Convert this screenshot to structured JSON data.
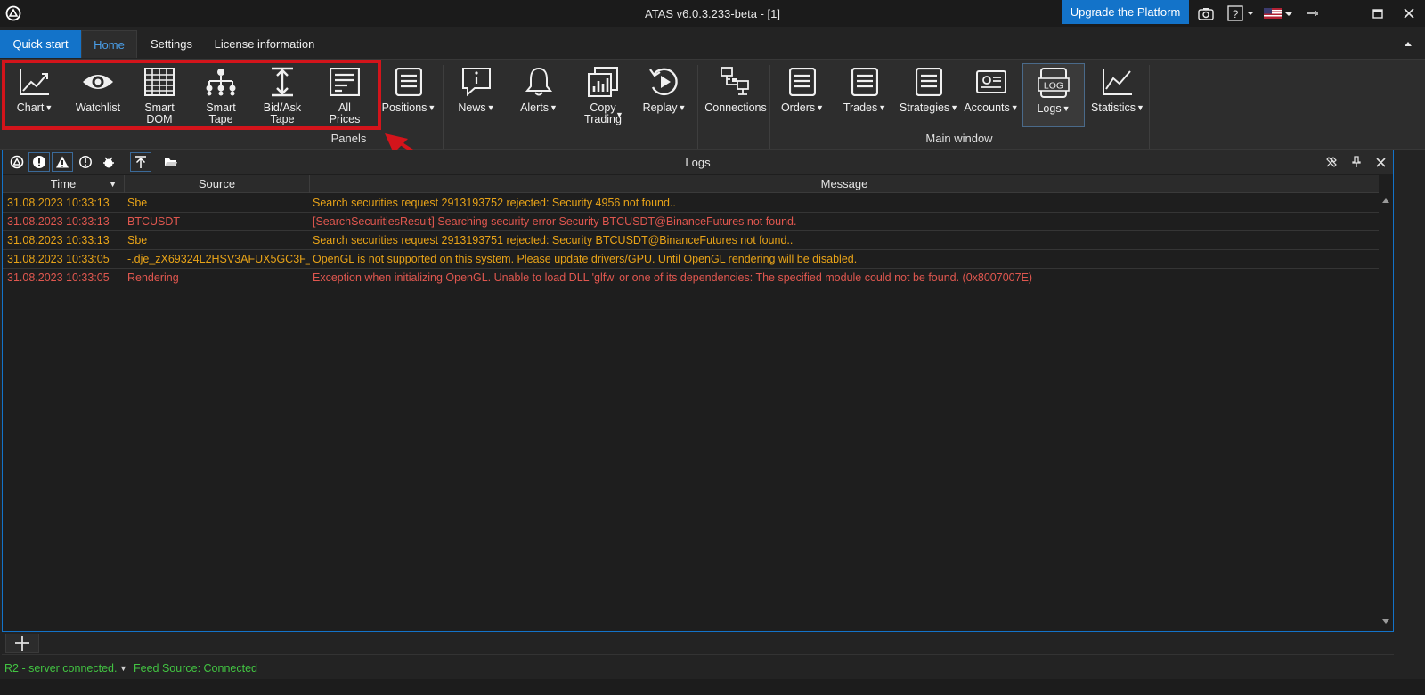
{
  "window": {
    "title": "ATAS v6.0.3.233-beta - [1]",
    "upgrade_label": "Upgrade the Platform",
    "icons": [
      "atas-logo-icon",
      "camera-icon",
      "help-icon",
      "us-flag-icon",
      "pin-icon",
      "maximize-icon",
      "close-icon"
    ]
  },
  "menu": {
    "tabs": [
      "Quick start",
      "Home",
      "Settings",
      "License information"
    ]
  },
  "ribbon": {
    "panels_group": {
      "label": "Panels",
      "buttons": [
        {
          "label": "Chart",
          "dropdown": true,
          "icon": "chart-icon"
        },
        {
          "label": "Watchlist",
          "dropdown": false,
          "icon": "eye-icon"
        },
        {
          "label": "Smart\nDOM",
          "dropdown": false,
          "icon": "grid-icon"
        },
        {
          "label": "Smart\nTape",
          "dropdown": false,
          "icon": "hierarchy-icon"
        },
        {
          "label": "Bid/Ask\nTape",
          "dropdown": false,
          "icon": "bidask-icon"
        },
        {
          "label": "All\nPrices",
          "dropdown": false,
          "icon": "list-icon"
        },
        {
          "label": "Positions",
          "dropdown": true,
          "icon": "document-icon"
        },
        {
          "label": "News",
          "dropdown": true,
          "icon": "info-bubble-icon"
        },
        {
          "label": "Alerts",
          "dropdown": true,
          "icon": "bell-icon"
        },
        {
          "label": "Copy\nTrading",
          "dropdown": true,
          "icon": "copy-trading-icon"
        },
        {
          "label": "Replay",
          "dropdown": true,
          "icon": "replay-icon"
        }
      ]
    },
    "connections_label": "Connections",
    "main_window_group": {
      "label": "Main window",
      "buttons": [
        {
          "label": "Orders",
          "dropdown": true,
          "icon": "document-icon"
        },
        {
          "label": "Trades",
          "dropdown": true,
          "icon": "document-icon"
        },
        {
          "label": "Strategies",
          "dropdown": true,
          "icon": "document-icon"
        },
        {
          "label": "Accounts",
          "dropdown": true,
          "icon": "account-icon"
        },
        {
          "label": "Logs",
          "dropdown": true,
          "icon": "log-icon",
          "selected": true
        },
        {
          "label": "Statistics",
          "dropdown": true,
          "icon": "statistics-icon"
        }
      ]
    },
    "log_icon_text": "LOG"
  },
  "logs": {
    "title": "Logs",
    "columns": [
      "Time",
      "Source",
      "Message"
    ],
    "rows": [
      {
        "time": "31.08.2023 10:33:13",
        "source": "Sbe",
        "message": "Search securities request 2913193752 rejected: Security 4956 not found..",
        "level": "warning"
      },
      {
        "time": "31.08.2023 10:33:13",
        "source": "BTCUSDT",
        "message": "[SearchSecuritiesResult] Searching security error Security BTCUSDT@BinanceFutures not found.",
        "level": "error"
      },
      {
        "time": "31.08.2023 10:33:13",
        "source": "Sbe",
        "message": "Search securities request 2913193751 rejected: Security BTCUSDT@BinanceFutures not found..",
        "level": "warning"
      },
      {
        "time": "31.08.2023 10:33:05",
        "source": "-.dje_zX69324L2HSV3AFUX5GC3F_...",
        "message": "OpenGL is not supported on this system. Please update drivers/GPU. Until OpenGL rendering will be disabled.",
        "level": "warning"
      },
      {
        "time": "31.08.2023 10:33:05",
        "source": "Rendering",
        "message": "Exception when initializing OpenGL.  Unable to load DLL 'glfw' or one of its dependencies: The specified module could not be found. (0x8007007E)",
        "level": "error"
      }
    ]
  },
  "status": {
    "server": "R2 - server connected.",
    "feed": "Feed Source: Connected"
  },
  "colors": {
    "accent": "#1373c9",
    "warning": "#e8a318",
    "error": "#e0574f",
    "connected": "#42c442",
    "highlight": "#d3141b"
  }
}
